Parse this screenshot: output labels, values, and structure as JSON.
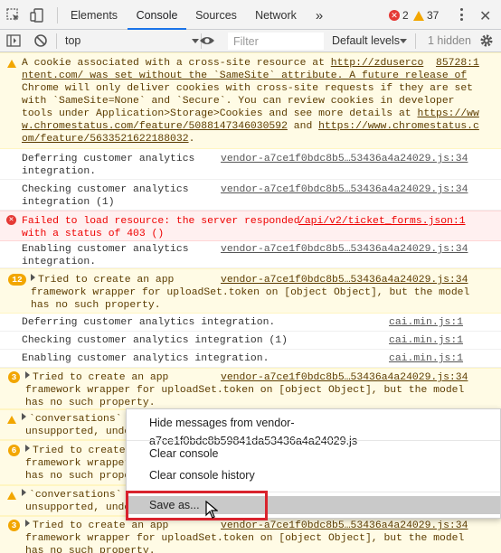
{
  "tabs": {
    "items": [
      {
        "label": "Elements"
      },
      {
        "label": "Console"
      },
      {
        "label": "Sources"
      },
      {
        "label": "Network"
      }
    ],
    "more": "»",
    "errors": "2",
    "warnings": "37"
  },
  "toolbar": {
    "context": "top",
    "filter_placeholder": "Filter",
    "levels": "Default levels",
    "hidden": "1 hidden"
  },
  "messages": [
    {
      "type": "warn",
      "lines": [
        "A cookie associated with a cross-site resource at ",
        "ntent.com/ was set without the `SameSite` attribute. A future release of",
        "Chrome will only deliver cookies with cross-site requests if they are set",
        "with `SameSite=None` and `Secure`. You can review cookies in developer",
        "tools under Application>Storage>Cookies and see more details at ",
        "w.chromestatus.com/feature/5088147346030592 and ",
        "om/feature/5633521622188032."
      ],
      "link1": "http://zduserco",
      "link1_tail": "85728:1",
      "link2": "https://ww",
      "link3": "https://www.chromestatus.c",
      "link3_lead": "w.chromestatus.com/feature/5088147346030592",
      "link4": "om/feature/5633521622188032"
    },
    {
      "type": "log",
      "text1": "Deferring customer analytics",
      "text2": "integration.",
      "source": "vendor-a7ce1f0bdc8b5…53436a4a24029.js:34"
    },
    {
      "type": "log",
      "text1": "Checking customer analytics",
      "text2": "integration (1)",
      "source": "vendor-a7ce1f0bdc8b5…53436a4a24029.js:34"
    },
    {
      "type": "err",
      "text1": "Failed to load resource: the server responded",
      "text2": "with a status of 403 ()",
      "source": "/api/v2/ticket_forms.json:1"
    },
    {
      "type": "log",
      "text1": "Enabling customer analytics",
      "text2": "integration.",
      "source": "vendor-a7ce1f0bdc8b5…53436a4a24029.js:34"
    },
    {
      "type": "warn",
      "count": "12",
      "text1": "Tried to create an app",
      "text2": "framework wrapper for uploadSet.token on [object Object], but the model",
      "text3": "has no such property.",
      "source": "vendor-a7ce1f0bdc8b5…53436a4a24029.js:34"
    },
    {
      "type": "log",
      "text1": "Deferring customer analytics integration.",
      "source": "cai.min.js:1"
    },
    {
      "type": "log",
      "text1": "Checking customer analytics integration (1)",
      "source": "cai.min.js:1"
    },
    {
      "type": "log",
      "text1": "Enabling customer analytics integration.",
      "source": "cai.min.js:1"
    },
    {
      "type": "warn",
      "count": "3",
      "text1": "Tried to create an app",
      "text2": "framework wrapper for uploadSet.token on [object Object], but the model",
      "text3": "has no such property.",
      "source": "vendor-a7ce1f0bdc8b5…53436a4a24029.js:34"
    },
    {
      "type": "warn",
      "text1": "`conversations`",
      "text2": "unsupported, undoc"
    },
    {
      "type": "warn",
      "count": "6",
      "text1": "Tried to create",
      "text2": "framework wrapper",
      "text3": "has no such prope"
    },
    {
      "type": "warn",
      "text1": "`conversations`",
      "text2": "unsupported, undoc"
    },
    {
      "type": "warn",
      "count": "3",
      "text1": "Tried to create an app",
      "text2": "framework wrapper for uploadSet.token on [object Object], but the model",
      "text3": "has no such property.",
      "source": "vendor-a7ce1f0bdc8b5…53436a4a24029.js:34"
    }
  ],
  "context_menu": {
    "hide": "Hide messages from vendor-a7ce1f0bdc8b59841da53436a4a24029.js",
    "clear": "Clear console",
    "clear_history": "Clear console history",
    "save_as": "Save as..."
  },
  "colors": {
    "accent": "#1a73e8",
    "warn_bg": "#fffbe5",
    "err_bg": "#fff0f0",
    "highlight_box": "#d9232d"
  }
}
